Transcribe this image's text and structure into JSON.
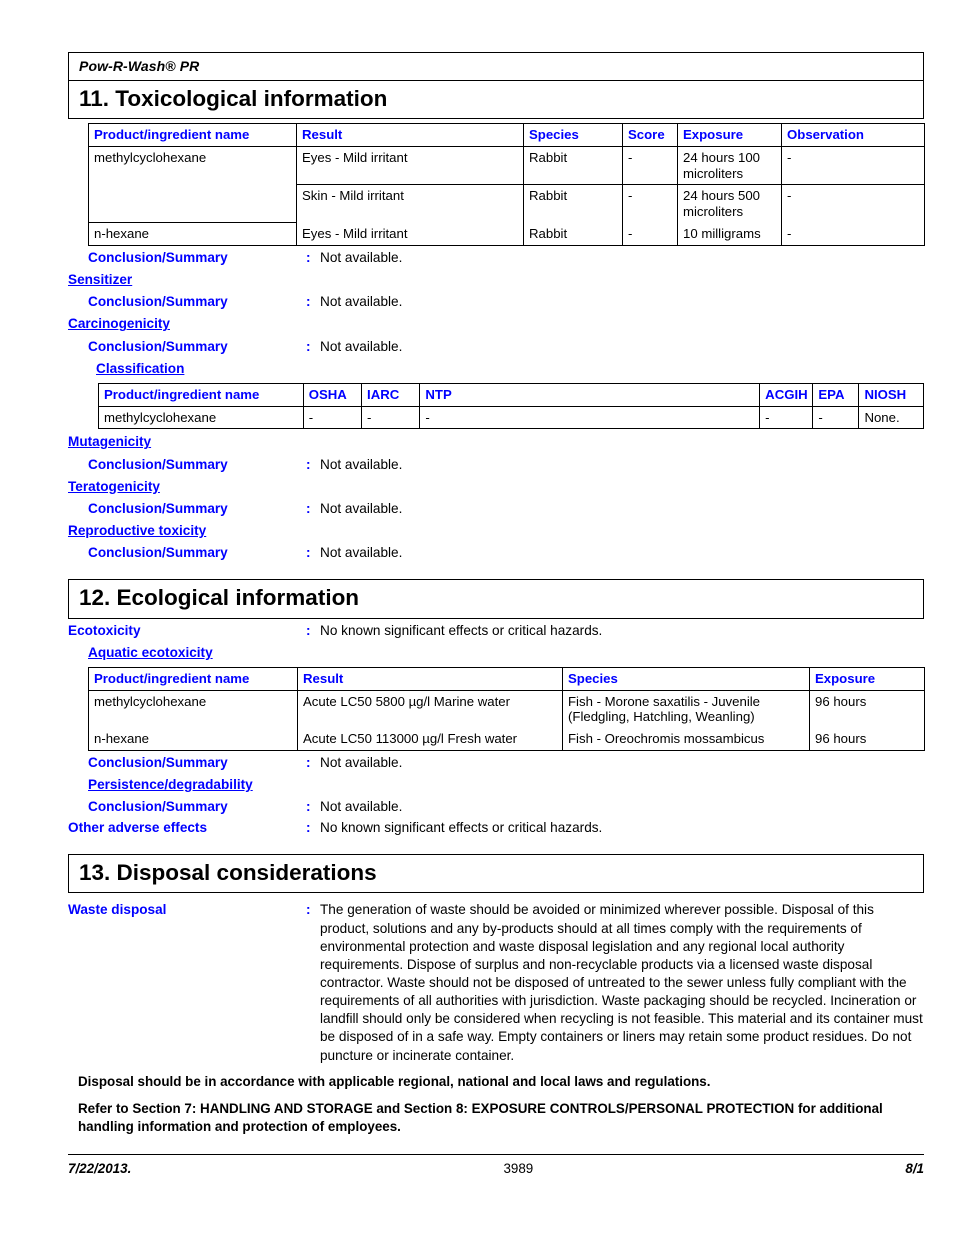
{
  "header": {
    "product_name": "Pow-R-Wash® PR"
  },
  "sections": {
    "toxicological": {
      "title": "11. Toxicological information",
      "tox_table": {
        "columns": [
          "Product/ingredient name",
          "Result",
          "Species",
          "Score",
          "Exposure",
          "Observation"
        ],
        "rows": [
          {
            "name": "methylcyclohexane",
            "result": "Eyes - Mild irritant",
            "species": "Rabbit",
            "score": "-",
            "exposure": "24 hours 100 microliters",
            "observation": "-"
          },
          {
            "name": "",
            "result": "Skin - Mild irritant",
            "species": "Rabbit",
            "score": "-",
            "exposure": "24 hours 500 microliters",
            "observation": "-"
          },
          {
            "name": "n-hexane",
            "result": "Eyes - Mild irritant",
            "species": "Rabbit",
            "score": "-",
            "exposure": "10 milligrams",
            "observation": "-"
          }
        ]
      },
      "conclusion_main": {
        "label": "Conclusion/Summary",
        "colon": ":",
        "value": "Not available."
      },
      "sensitizer": {
        "heading": "Sensitizer",
        "conclusion_label": "Conclusion/Summary",
        "colon": ":",
        "conclusion_value": "Not available."
      },
      "carcinogenicity": {
        "heading": "Carcinogenicity",
        "conclusion_label": "Conclusion/Summary",
        "colon": ":",
        "conclusion_value": "Not available.",
        "classification_heading": "Classification",
        "classification_table": {
          "columns": [
            "Product/ingredient name",
            "OSHA",
            "IARC",
            "NTP",
            "ACGIH",
            "EPA",
            "NIOSH"
          ],
          "rows": [
            {
              "name": "methylcyclohexane",
              "osha": "-",
              "iarc": "-",
              "ntp": "-",
              "acgih": "-",
              "epa": "-",
              "niosh": "None."
            }
          ]
        }
      },
      "mutagenicity": {
        "heading": "Mutagenicity",
        "conclusion_label": "Conclusion/Summary",
        "colon": ":",
        "conclusion_value": "Not available."
      },
      "teratogenicity": {
        "heading": "Teratogenicity",
        "conclusion_label": "Conclusion/Summary",
        "colon": ":",
        "conclusion_value": "Not available."
      },
      "reproductive_toxicity": {
        "heading": "Reproductive toxicity",
        "conclusion_label": "Conclusion/Summary",
        "colon": ":",
        "conclusion_value": "Not available."
      }
    },
    "ecological": {
      "title": "12. Ecological information",
      "ecotoxicity": {
        "label": "Ecotoxicity",
        "colon": ":",
        "value": "No known significant effects or critical hazards."
      },
      "aquatic_heading": "Aquatic ecotoxicity",
      "aquatic_table": {
        "columns": [
          "Product/ingredient name",
          "Result",
          "Species",
          "Exposure"
        ],
        "rows": [
          {
            "name": "methylcyclohexane",
            "result": "Acute LC50 5800 µg/l Marine water",
            "species": "Fish - Morone saxatilis - Juvenile (Fledgling, Hatchling, Weanling)",
            "exposure": "96 hours"
          },
          {
            "name": "n-hexane",
            "result": "Acute LC50 113000 µg/l Fresh water",
            "species": "Fish - Oreochromis mossambicus",
            "exposure": "96 hours"
          }
        ]
      },
      "conclusion_aquatic": {
        "label": "Conclusion/Summary",
        "colon": ":",
        "value": "Not available."
      },
      "persistence": {
        "heading": "Persistence/degradability",
        "conclusion_label": "Conclusion/Summary",
        "colon": ":",
        "conclusion_value": "Not available."
      },
      "other_adverse_effects": {
        "label": "Other adverse effects",
        "colon": ":",
        "value": "No known significant effects or critical hazards."
      }
    },
    "disposal": {
      "title": "13. Disposal considerations",
      "waste_disposal": {
        "label": "Waste disposal",
        "colon": ":",
        "value": "The generation of waste should be avoided or minimized wherever possible.  Disposal of this product, solutions and any by-products should at all times comply with the requirements of environmental protection and waste disposal legislation and any regional local authority requirements.  Dispose of surplus and non-recyclable products via a licensed waste disposal contractor.  Waste should not be disposed of untreated to the sewer unless fully compliant with the requirements of all authorities with jurisdiction.  Waste packaging should be recycled.  Incineration or landfill should only be considered when recycling is not feasible.  This material and its container must be disposed of in a safe way.  Empty containers or liners may retain some product residues.  Do not puncture or incinerate container."
      },
      "note_1": "Disposal should be in accordance with applicable regional, national and local laws and regulations.",
      "note_2": "Refer to Section 7: HANDLING AND STORAGE and Section 8: EXPOSURE CONTROLS/PERSONAL PROTECTION for additional handling information and protection of employees."
    }
  },
  "footer": {
    "date": "7/22/2013.",
    "doc_number": "3989",
    "page": "8/1"
  },
  "colors": {
    "heading_blue": "#0000ff",
    "text_black": "#000000",
    "border_black": "#000000"
  }
}
